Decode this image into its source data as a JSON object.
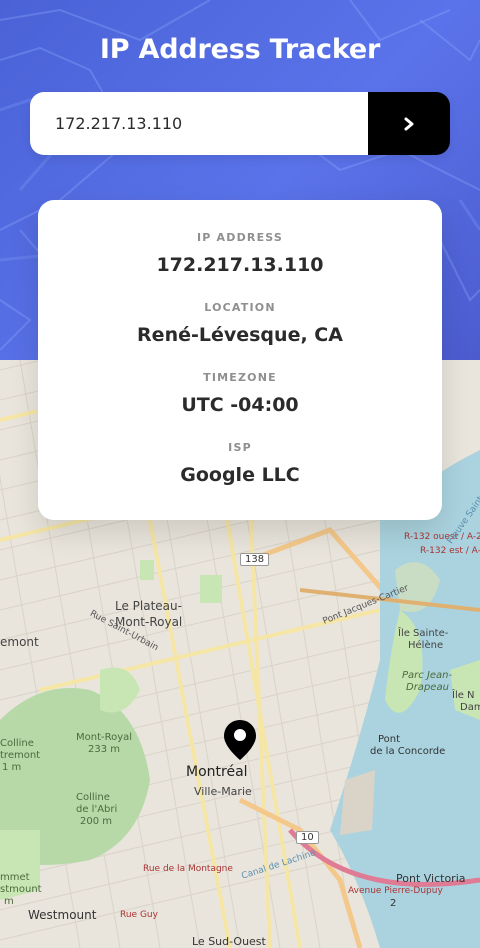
{
  "header": {
    "title": "IP Address Tracker"
  },
  "search": {
    "value": "172.217.13.110",
    "submit_icon": "chevron-right-icon"
  },
  "info": {
    "ip_label": "IP ADDRESS",
    "ip_value": "172.217.13.110",
    "location_label": "LOCATION",
    "location_value": "René-Lévesque, CA",
    "timezone_label": "TIMEZONE",
    "timezone_value": "UTC -04:00",
    "isp_label": "ISP",
    "isp_value": "Google LLC"
  },
  "map": {
    "marker_icon": "location-pin-icon",
    "labels": {
      "montreal": "Montréal",
      "ville_marie": "Ville-Marie",
      "plateau": "Le Plateau-",
      "mont_royal_borough": "Mont-Royal",
      "mont_royal": "Mont-Royal",
      "mont_royal_elev": "233 m",
      "colline_abri": "Colline",
      "colline_abri2": "de l'Abri",
      "colline_abri_elev": "200 m",
      "westmount": "Westmount",
      "sud_ouest": "Le Sud-Ouest",
      "pont_concorde": "Pont",
      "pont_concorde2": "de la Concorde",
      "ile_sainte_helene": "Île Sainte-",
      "ile_sainte_helene2": "Hélène",
      "parc_jean_drapeau": "Parc Jean-",
      "parc_jean_drapeau2": "Drapeau",
      "pont_victoria": "Pont Victoria",
      "rue_saint_urbain": "Rue Saint-Urbain",
      "pont_jacques_cartier": "Pont Jacques-Cartier",
      "rue_montagne": "Rue de la Montagne",
      "rue_guy": "Rue Guy",
      "avenue_pierre_dupuy": "Avenue Pierre-Dupuy",
      "r132_ouest": "R-132 ouest / A-2",
      "r132_est": "R-132 est / A-2",
      "route_138": "138",
      "route_10": "10",
      "outremont": "emont",
      "colline_outremont": "Colline",
      "colline_outremont2": "tremont",
      "colline_outremont_elev": "1 m",
      "summit_westmount": "mmet",
      "summit_westmount2": "stmount",
      "summit_westmount_elev": "m",
      "ile_notre_dame": "Île N",
      "ile_notre_dame2": "Dam",
      "canal": "Canal de Lachine",
      "fleuve": "Fleuve Saint-Laurent",
      "route_2": "2"
    }
  }
}
